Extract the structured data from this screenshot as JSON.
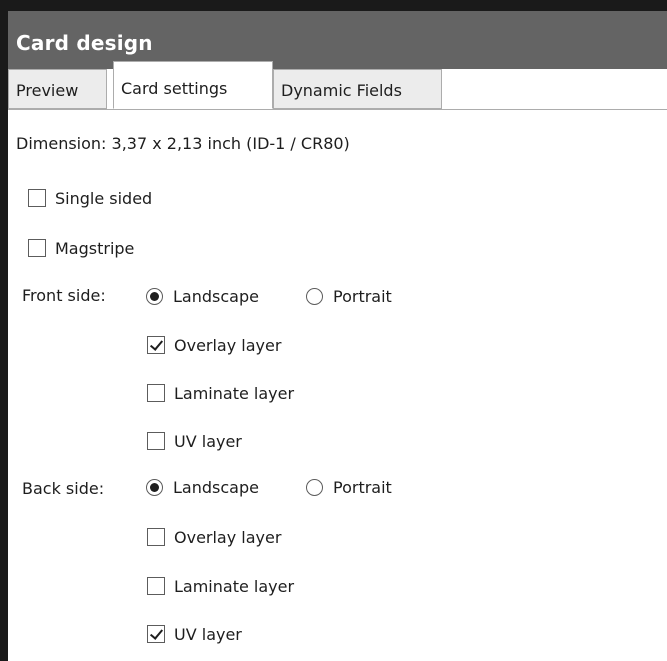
{
  "panel": {
    "title": "Card design"
  },
  "tabs": [
    {
      "label": "Preview",
      "active": false
    },
    {
      "label": "Card settings",
      "active": true
    },
    {
      "label": "Dynamic Fields",
      "active": false
    }
  ],
  "settings": {
    "dimension": "Dimension: 3,37 x 2,13 inch (ID-1 / CR80)",
    "single_sided": {
      "label": "Single sided",
      "checked": false
    },
    "magstripe": {
      "label": "Magstripe",
      "checked": false
    },
    "front": {
      "label": "Front side:",
      "landscape": {
        "label": "Landscape",
        "selected": true
      },
      "portrait": {
        "label": "Portrait",
        "selected": false
      },
      "overlay": {
        "label": "Overlay layer",
        "checked": true
      },
      "laminate": {
        "label": "Laminate layer",
        "checked": false
      },
      "uv": {
        "label": "UV layer",
        "checked": false
      }
    },
    "back": {
      "label": "Back side:",
      "landscape": {
        "label": "Landscape",
        "selected": true
      },
      "portrait": {
        "label": "Portrait",
        "selected": false
      },
      "overlay": {
        "label": "Overlay layer",
        "checked": false
      },
      "laminate": {
        "label": "Laminate layer",
        "checked": false
      },
      "uv": {
        "label": "UV layer",
        "checked": true
      }
    }
  }
}
